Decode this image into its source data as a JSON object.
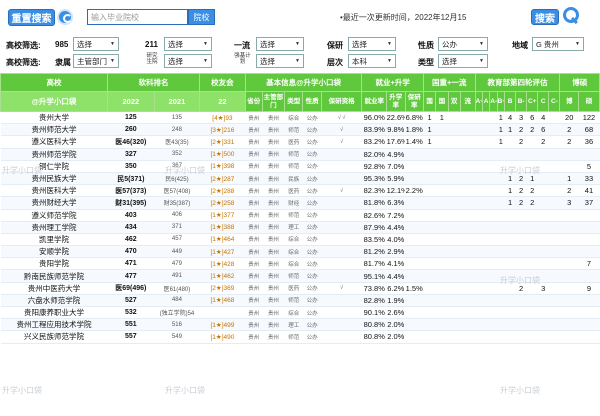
{
  "topbar": {
    "advanced_search": "重置搜索",
    "search_placeholder": "输入毕业院校",
    "school_btn": "院校",
    "update_text": "•最近一次更新时间，2022年12月15",
    "search_btn": "搜索"
  },
  "filters": {
    "row1_label": "高校筛选:",
    "row2_label": "高校筛选:",
    "f985": {
      "label": "985",
      "value": "选择"
    },
    "f211": {
      "label": "211",
      "value": "选择"
    },
    "f_first": {
      "label": "一流",
      "value": "选择"
    },
    "f_grad": {
      "label": "保研",
      "value": "选择"
    },
    "f_nature": {
      "label": "性质",
      "value": "公办"
    },
    "f_region": {
      "label": "地域",
      "value": "G 贵州"
    },
    "f_affil": {
      "label": "隶属",
      "value": "主管部门"
    },
    "f_research": {
      "label": "研究生院",
      "value": "选择"
    },
    "f_basic": {
      "label": "强基计划",
      "value": "选择"
    },
    "f_level": {
      "label": "层次",
      "value": "本科"
    },
    "f_type": {
      "label": "类型",
      "value": "选择"
    }
  },
  "header": {
    "g_school": "高校",
    "g_soft": "软科排名",
    "g_alumni": "校友会",
    "g_basic": "基本信息@升学小口袋",
    "g_employ": "就业+升学",
    "g_national": "国重+一流",
    "g_eval": "教育部第四轮评估",
    "g_doctor": "博硕",
    "sub_brand": "@升学小口袋",
    "y2022": "2022",
    "y2021": "2021",
    "y22": "22",
    "c_prov": "省份",
    "c_dept": "主管部门",
    "c_kind": "类型",
    "c_nature": "性质",
    "c_first": "一流大学",
    "c_firstsub": "一流学科",
    "c_res": "研究生院",
    "c_9": "9",
    "c_8": "8",
    "c_5": "5",
    "c_2": "2",
    "c_1": "1",
    "c_plan": "强基计划",
    "c_grad": "保研资格",
    "c_emp": "就业率",
    "c_up": "升学率",
    "c_gradrate": "保研率",
    "c_n1": "国",
    "c_n2": "国",
    "c_n3": "双",
    "c_nsub1": "重",
    "c_nsub2": "1",
    "c_nsub3": "2",
    "c_nsub4": "流",
    "e_aplus": "A+",
    "e_a": "A",
    "e_aminus": "A-",
    "e_bplus": "B+",
    "e_b": "B",
    "e_bminus": "B-",
    "e_cplus": "C+",
    "e_c": "C",
    "e_cminus": "C-",
    "d_doc": "博",
    "d_mas": "硕"
  },
  "rows": [
    {
      "name": "贵州大学",
      "r22": "125",
      "r21": "135",
      "alu": "[4★]93",
      "prov": "贵州",
      "dept": "贵州",
      "kind": "综合",
      "nat": "公办",
      "flags": "√       √",
      "emp": "96.0%",
      "up": "22.6%",
      "gr": "6.8%",
      "n1": "1",
      "n2": "1",
      "e1": "",
      "e2": "",
      "e3": "1",
      "e4": "4",
      "e5": "3",
      "e6": "6",
      "e7": "4",
      "d1": "20",
      "d2": "122"
    },
    {
      "name": "贵州师范大学",
      "r22": "260",
      "r21": "248",
      "alu": "[3★]216",
      "prov": "贵州",
      "dept": "贵州",
      "kind": "师范",
      "nat": "公办",
      "flags": "        √",
      "emp": "83.9%",
      "up": "9.8%",
      "gr": "1.8%",
      "n1": "1",
      "n2": "",
      "e1": "",
      "e2": "",
      "e3": "1",
      "e4": "1",
      "e5": "2",
      "e6": "2",
      "e7": "6",
      "d1": "2",
      "d2": "68"
    },
    {
      "name": "遵义医科大学",
      "r22": "医46(320)",
      "r21": "医43(35)",
      "alu": "[2★]331",
      "prov": "贵州",
      "dept": "贵州",
      "kind": "医药",
      "nat": "公办",
      "flags": "        √",
      "emp": "83.2%",
      "up": "17.6%",
      "gr": "1.4%",
      "n1": "1",
      "n2": "",
      "e1": "",
      "e2": "",
      "e3": "1",
      "e4": "",
      "e5": "2",
      "e6": "",
      "e7": "2",
      "d1": "2",
      "d2": "36"
    },
    {
      "name": "贵州师范学院",
      "r22": "327",
      "r21": "352",
      "alu": "[1★]500",
      "prov": "贵州",
      "dept": "贵州",
      "kind": "师范",
      "nat": "公办",
      "flags": "",
      "emp": "82.0%",
      "up": "4.9%",
      "gr": "",
      "n1": "",
      "n2": "",
      "e1": "",
      "e2": "",
      "e3": "",
      "e4": "",
      "e5": "",
      "e6": "",
      "e7": "",
      "d1": "",
      "d2": ""
    },
    {
      "name": "铜仁学院",
      "r22": "350",
      "r21": "367",
      "alu": "[1★]398",
      "prov": "贵州",
      "dept": "贵州",
      "kind": "师范",
      "nat": "公办",
      "flags": "",
      "emp": "92.8%",
      "up": "7.0%",
      "gr": "",
      "n1": "",
      "n2": "",
      "e1": "",
      "e2": "",
      "e3": "",
      "e4": "",
      "e5": "",
      "e6": "",
      "e7": "",
      "d1": "",
      "d2": "5"
    },
    {
      "name": "贵州民族大学",
      "r22": "民5(371)",
      "r21": "民6(425)",
      "alu": "[2★]287",
      "prov": "贵州",
      "dept": "贵州",
      "kind": "民族",
      "nat": "公办",
      "flags": "",
      "emp": "95.3%",
      "up": "5.9%",
      "gr": "",
      "n1": "",
      "n2": "",
      "e1": "",
      "e2": "",
      "e3": "",
      "e4": "1",
      "e5": "2",
      "e6": "1",
      "e7": "",
      "d1": "1",
      "d2": "33"
    },
    {
      "name": "贵州医科大学",
      "r22": "医57(373)",
      "r21": "医57(408)",
      "alu": "[2★]288",
      "prov": "贵州",
      "dept": "贵州",
      "kind": "医药",
      "nat": "公办",
      "flags": "        √",
      "emp": "82.3%",
      "up": "12.1%",
      "gr": "2.2%",
      "n1": "",
      "n2": "",
      "e1": "",
      "e2": "",
      "e3": "",
      "e4": "1",
      "e5": "2",
      "e6": "2",
      "e7": "",
      "d1": "2",
      "d2": "41"
    },
    {
      "name": "贵州财经大学",
      "r22": "财31(395)",
      "r21": "财35(387)",
      "alu": "[2★]258",
      "prov": "贵州",
      "dept": "贵州",
      "kind": "财经",
      "nat": "公办",
      "flags": "",
      "emp": "81.8%",
      "up": "6.3%",
      "gr": "",
      "n1": "",
      "n2": "",
      "e1": "",
      "e2": "",
      "e3": "",
      "e4": "1",
      "e5": "2",
      "e6": "2",
      "e7": "",
      "d1": "3",
      "d2": "37"
    },
    {
      "name": "遵义师范学院",
      "r22": "403",
      "r21": "406",
      "alu": "[1★]377",
      "prov": "贵州",
      "dept": "贵州",
      "kind": "师范",
      "nat": "公办",
      "flags": "",
      "emp": "82.6%",
      "up": "7.2%",
      "gr": "",
      "n1": "",
      "n2": "",
      "e1": "",
      "e2": "",
      "e3": "",
      "e4": "",
      "e5": "",
      "e6": "",
      "e7": "",
      "d1": "",
      "d2": ""
    },
    {
      "name": "贵州理工学院",
      "r22": "434",
      "r21": "371",
      "alu": "[1★]388",
      "prov": "贵州",
      "dept": "贵州",
      "kind": "理工",
      "nat": "公办",
      "flags": "",
      "emp": "87.9%",
      "up": "4.4%",
      "gr": "",
      "n1": "",
      "n2": "",
      "e1": "",
      "e2": "",
      "e3": "",
      "e4": "",
      "e5": "",
      "e6": "",
      "e7": "",
      "d1": "",
      "d2": ""
    },
    {
      "name": "凯里学院",
      "r22": "462",
      "r21": "457",
      "alu": "[1★]464",
      "prov": "贵州",
      "dept": "贵州",
      "kind": "综合",
      "nat": "公办",
      "flags": "",
      "emp": "83.5%",
      "up": "4.0%",
      "gr": "",
      "n1": "",
      "n2": "",
      "e1": "",
      "e2": "",
      "e3": "",
      "e4": "",
      "e5": "",
      "e6": "",
      "e7": "",
      "d1": "",
      "d2": ""
    },
    {
      "name": "安顺学院",
      "r22": "470",
      "r21": "449",
      "alu": "[1★]427",
      "prov": "贵州",
      "dept": "贵州",
      "kind": "综合",
      "nat": "公办",
      "flags": "",
      "emp": "81.2%",
      "up": "2.9%",
      "gr": "",
      "n1": "",
      "n2": "",
      "e1": "",
      "e2": "",
      "e3": "",
      "e4": "",
      "e5": "",
      "e6": "",
      "e7": "",
      "d1": "",
      "d2": ""
    },
    {
      "name": "贵阳学院",
      "r22": "471",
      "r21": "479",
      "alu": "[1★]428",
      "prov": "贵州",
      "dept": "贵州",
      "kind": "综合",
      "nat": "公办",
      "flags": "",
      "emp": "81.7%",
      "up": "4.1%",
      "gr": "",
      "n1": "",
      "n2": "",
      "e1": "",
      "e2": "",
      "e3": "",
      "e4": "",
      "e5": "",
      "e6": "",
      "e7": "",
      "d1": "",
      "d2": "7"
    },
    {
      "name": "黔南民族师范学院",
      "r22": "477",
      "r21": "491",
      "alu": "[1★]462",
      "prov": "贵州",
      "dept": "贵州",
      "kind": "师范",
      "nat": "公办",
      "flags": "",
      "emp": "95.1%",
      "up": "4.4%",
      "gr": "",
      "n1": "",
      "n2": "",
      "e1": "",
      "e2": "",
      "e3": "",
      "e4": "",
      "e5": "",
      "e6": "",
      "e7": "",
      "d1": "",
      "d2": ""
    },
    {
      "name": "贵州中医药大学",
      "r22": "医69(496)",
      "r21": "医61(480)",
      "alu": "[2★]369",
      "prov": "贵州",
      "dept": "贵州",
      "kind": "医药",
      "nat": "公办",
      "flags": "        √",
      "emp": "73.8%",
      "up": "6.2%",
      "gr": "1.5%",
      "n1": "",
      "n2": "",
      "e1": "",
      "e2": "",
      "e3": "",
      "e4": "",
      "e5": "2",
      "e6": "",
      "e7": "3",
      "d1": "",
      "d2": "9"
    },
    {
      "name": "六盘水师范学院",
      "r22": "527",
      "r21": "484",
      "alu": "[1★]468",
      "prov": "贵州",
      "dept": "贵州",
      "kind": "师范",
      "nat": "公办",
      "flags": "",
      "emp": "82.8%",
      "up": "1.9%",
      "gr": "",
      "n1": "",
      "n2": "",
      "e1": "",
      "e2": "",
      "e3": "",
      "e4": "",
      "e5": "",
      "e6": "",
      "e7": "",
      "d1": "",
      "d2": ""
    },
    {
      "name": "贵阳康养职业大学",
      "r22": "532",
      "r21": "(独立学院)54",
      "alu": "",
      "prov": "贵州",
      "dept": "贵州",
      "kind": "综合",
      "nat": "公办",
      "flags": "",
      "emp": "90.1%",
      "up": "2.6%",
      "gr": "",
      "n1": "",
      "n2": "",
      "e1": "",
      "e2": "",
      "e3": "",
      "e4": "",
      "e5": "",
      "e6": "",
      "e7": "",
      "d1": "",
      "d2": ""
    },
    {
      "name": "贵州工程应用技术学院",
      "r22": "551",
      "r21": "516",
      "alu": "[1★]499",
      "prov": "贵州",
      "dept": "贵州",
      "kind": "理工",
      "nat": "公办",
      "flags": "",
      "emp": "80.8%",
      "up": "2.0%",
      "gr": "",
      "n1": "",
      "n2": "",
      "e1": "",
      "e2": "",
      "e3": "",
      "e4": "",
      "e5": "",
      "e6": "",
      "e7": "",
      "d1": "",
      "d2": ""
    },
    {
      "name": "兴义民族师范学院",
      "r22": "557",
      "r21": "549",
      "alu": "[1★]490",
      "prov": "贵州",
      "dept": "贵州",
      "kind": "师范",
      "nat": "公办",
      "flags": "",
      "emp": "80.8%",
      "up": "2.0%",
      "gr": "",
      "n1": "",
      "n2": "",
      "e1": "",
      "e2": "",
      "e3": "",
      "e4": "",
      "e5": "",
      "e6": "",
      "e7": "",
      "d1": "",
      "d2": ""
    }
  ],
  "watermark": "升学小口袋"
}
